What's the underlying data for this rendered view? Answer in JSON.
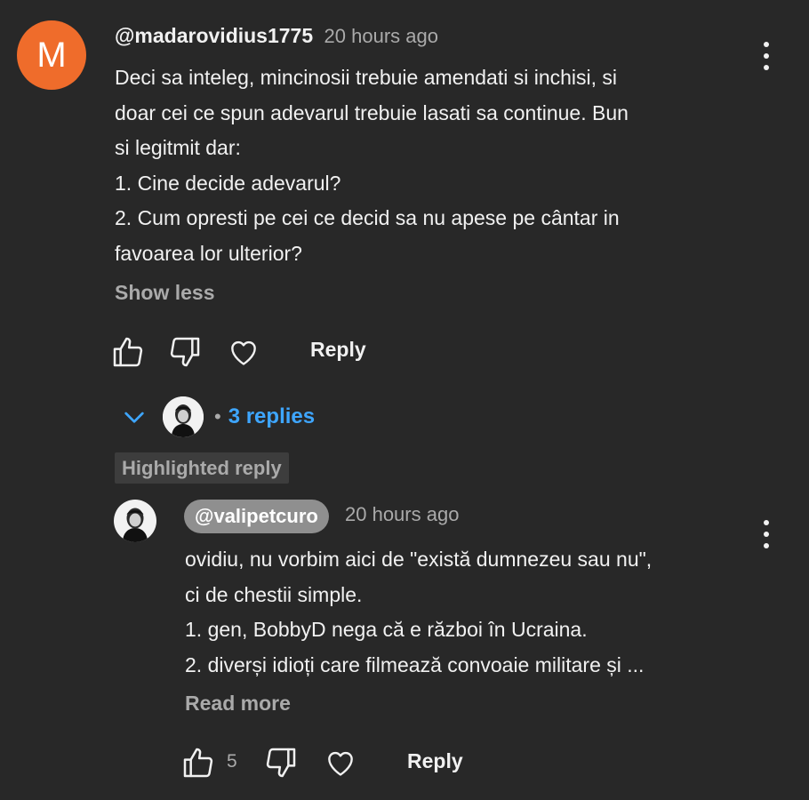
{
  "comment": {
    "avatar_letter": "M",
    "avatar_color": "#ef6c2b",
    "author": "@madarovidius1775",
    "time": "20 hours ago",
    "lines": [
      "Deci sa inteleg, mincinosii trebuie amendati si inchisi, si",
      "doar cei ce spun adevarul trebuie lasati sa continue. Bun",
      "si legitmit dar:",
      "1. Cine decide adevarul?",
      "2. Cum opresti pe cei ce decid sa nu apese pe cântar in",
      "favoarea lor ulterior?"
    ],
    "show_less": "Show less",
    "reply_label": "Reply"
  },
  "replies": {
    "toggle_separator": "•",
    "count_label": "3 replies",
    "link_color": "#3ea6ff"
  },
  "highlighted_reply": {
    "badge": "Highlighted reply",
    "author": "@valipetcuro",
    "time": "20 hours ago",
    "lines": [
      "ovidiu, nu vorbim aici de \"există dumnezeu sau nu\",",
      "ci de chestii simple.",
      "1. gen, BobbyD nega că e război în Ucraina.",
      "2. diverși idioți care filmează convoaie militare și ..."
    ],
    "read_more": "Read more",
    "like_count": "5",
    "reply_label": "Reply"
  },
  "icons": {
    "like": "thumbs-up-icon",
    "dislike": "thumbs-down-icon",
    "heart": "heart-icon",
    "more": "more-vert-icon",
    "chevron": "chevron-down-icon"
  }
}
